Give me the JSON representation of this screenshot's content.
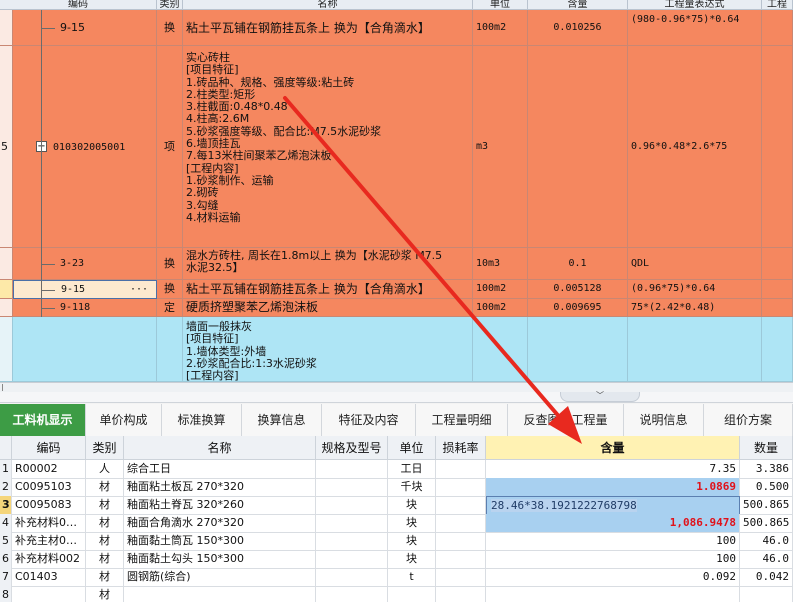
{
  "top_header": [
    "编码",
    "类别",
    "名称",
    "单位",
    "含量",
    "工程量表达式",
    "工程"
  ],
  "top_rows": [
    {
      "code": "9-15",
      "type": "换",
      "name_lines": [
        "粘土平瓦铺在钢筋挂瓦条上  换为【合角滴水】"
      ],
      "unit": "100m2",
      "qty": "0.010256",
      "expr": "(980-0.96*75)*0.64"
    },
    {
      "row_num": "5",
      "toggle": "−",
      "code": "010302005001",
      "type": "项",
      "name_lines": [
        "实心砖柱",
        "[项目特征]",
        "1.砖品种、规格、强度等级:粘土砖",
        "2.柱类型:矩形",
        "3.柱截面:0.48*0.48",
        "4.柱高:2.6M",
        "5.砂浆强度等级、配合比:M7.5水泥砂浆",
        "6.墙顶挂瓦",
        "7.每13米柱间聚苯乙烯泡沫板",
        "[工程内容]",
        "1.砂浆制作、运输",
        "2.砌砖",
        "3.勾缝",
        "4.材料运输"
      ],
      "unit": "m3",
      "qty": "",
      "expr": "0.96*0.48*2.6*75"
    },
    {
      "code": "3-23",
      "type": "换",
      "name_lines": [
        "混水方砖柱, 周长在1.8m以上  换为【水泥砂浆 M7.5",
        "水泥32.5】"
      ],
      "unit": "10m3",
      "qty": "0.1",
      "expr": "QDL"
    },
    {
      "code": "9-15",
      "ellipsis": "···",
      "type": "换",
      "name_lines": [
        "粘土平瓦铺在钢筋挂瓦条上  换为【合角滴水】"
      ],
      "unit": "100m2",
      "qty": "0.005128",
      "expr": "(0.96*75)*0.64"
    },
    {
      "code": "9-118",
      "type": "定",
      "name_lines": [
        "硬质挤塑聚苯乙烯泡沫板"
      ],
      "unit": "100m2",
      "qty": "0.009695",
      "expr": "75*(2.42*0.48)"
    },
    {
      "code": "",
      "type": "",
      "name_lines": [
        "墙面一般抹灰",
        "[项目特征]",
        "1.墙体类型:外墙",
        "2.砂浆配合比:1:3水泥砂浆",
        "[工程内容]"
      ],
      "unit": "",
      "qty": "",
      "expr": ""
    }
  ],
  "tabs": [
    "工料机显示",
    "单价构成",
    "标准换算",
    "换算信息",
    "特征及内容",
    "工程量明细",
    "反查图形工程量",
    "说明信息",
    "组价方案"
  ],
  "grid_header": [
    "",
    "编码",
    "类别",
    "名称",
    "规格及型号",
    "单位",
    "损耗率",
    "含量",
    "数量"
  ],
  "grid_rows": [
    {
      "n": "1",
      "code": "R00002",
      "type": "人",
      "name": "综合工日",
      "spec": "",
      "unit": "工日",
      "loss": "",
      "qty": "7.35",
      "amount": "3.386"
    },
    {
      "n": "2",
      "code": "C0095103",
      "type": "材",
      "name": "釉面粘土板瓦 270*320",
      "spec": "",
      "unit": "千块",
      "loss": "",
      "qty": "1.0869",
      "amount": "0.500"
    },
    {
      "n": "3",
      "code": "C0095083",
      "type": "材",
      "name": "釉面粘土脊瓦 320*260",
      "spec": "",
      "unit": "块",
      "loss": "",
      "qty": "28.46*38.1921222768798",
      "amount": "500.865"
    },
    {
      "n": "4",
      "code": "补充材料0…",
      "type": "材",
      "name": "釉面合角滴水 270*320",
      "spec": "",
      "unit": "块",
      "loss": "",
      "qty": "1,086.9478",
      "amount": "500.865"
    },
    {
      "n": "5",
      "code": "补充主材0…",
      "type": "材",
      "name": "釉面黏土筒瓦 150*300",
      "spec": "",
      "unit": "块",
      "loss": "",
      "qty": "100",
      "amount": "46.0"
    },
    {
      "n": "6",
      "code": "补充材料002",
      "type": "材",
      "name": "釉面黏土勾头 150*300",
      "spec": "",
      "unit": "块",
      "loss": "",
      "qty": "100",
      "amount": "46.0"
    },
    {
      "n": "7",
      "code": "C01403",
      "type": "材",
      "name": "圆钢筋(综合)",
      "spec": "",
      "unit": "t",
      "loss": "",
      "qty": "0.092",
      "amount": "0.042"
    },
    {
      "n": "8",
      "code": "",
      "type": "材",
      "name": "",
      "spec": "",
      "unit": "",
      "loss": "",
      "qty": "",
      "amount": ""
    }
  ],
  "colors": {
    "row_orange": "#f5875f",
    "row_blue": "#aee5f5",
    "accent_green": "#3d9c45",
    "header_yellow": "#fff2b3",
    "red_text": "#e0121a",
    "sel_blue": "#a8d0f0",
    "arrow_red": "#e8291f"
  },
  "arrow": {
    "icon": "red-arrow"
  }
}
